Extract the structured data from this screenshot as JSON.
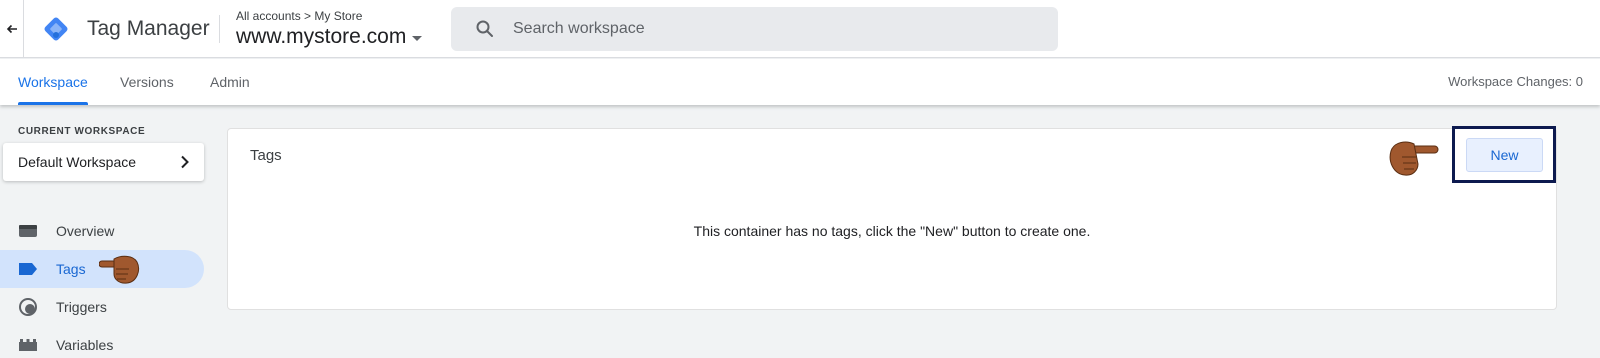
{
  "header": {
    "app_title": "Tag Manager",
    "breadcrumb": "All accounts > My Store",
    "container": "www.mystore.com",
    "search_placeholder": "Search workspace",
    "icons": {
      "back": "arrow-back-icon",
      "logo": "tag-manager-logo",
      "search": "search-icon",
      "dropdown": "caret-down-icon"
    }
  },
  "tabs": [
    {
      "label": "Workspace",
      "active": true
    },
    {
      "label": "Versions",
      "active": false
    },
    {
      "label": "Admin",
      "active": false
    }
  ],
  "workspace_changes": "Workspace Changes: 0",
  "sidebar": {
    "current_workspace_label": "CURRENT WORKSPACE",
    "workspace_name": "Default Workspace",
    "items": [
      {
        "label": "Overview",
        "icon": "folder-icon",
        "active": false
      },
      {
        "label": "Tags",
        "icon": "tag-icon",
        "active": true
      },
      {
        "label": "Triggers",
        "icon": "trigger-icon",
        "active": false
      },
      {
        "label": "Variables",
        "icon": "variables-icon",
        "active": false
      }
    ]
  },
  "main": {
    "card_title": "Tags",
    "empty_message": "This container has no tags, click the \"New\" button to create one.",
    "new_button": "New"
  },
  "colors": {
    "accent": "#1a73e8",
    "active_nav_bg": "#d2e3fc",
    "highlight_border": "#0d1a4f",
    "hand": "#a0582e"
  }
}
